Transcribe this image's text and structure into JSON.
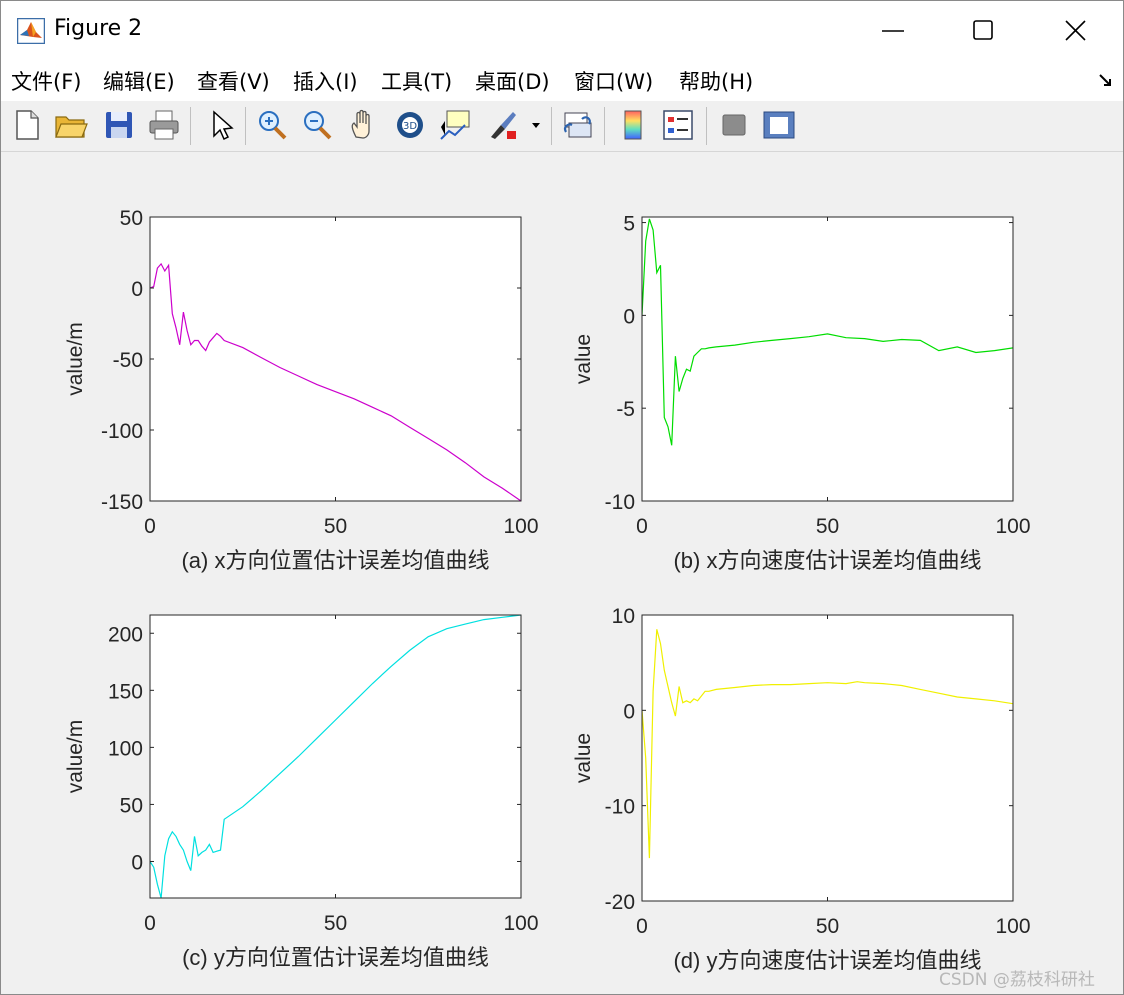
{
  "window": {
    "title": "Figure 2"
  },
  "menu": [
    "文件(F)",
    "编辑(E)",
    "查看(V)",
    "插入(I)",
    "工具(T)",
    "桌面(D)",
    "窗口(W)",
    "帮助(H)"
  ],
  "toolbar": [
    "new-file-icon",
    "open-file-icon",
    "save-icon",
    "print-icon",
    "pointer-icon",
    "zoom-in-icon",
    "zoom-out-icon",
    "pan-icon",
    "rotate-3d-icon",
    "data-cursor-icon",
    "brush-icon",
    "link-plot-icon",
    "colorbar-icon",
    "legend-icon",
    "hide-plot-tools-icon",
    "show-plot-tools-icon"
  ],
  "watermark": "CSDN @荔枝科研社",
  "chart_data": [
    {
      "type": "line",
      "caption": "(a) x方向位置估计误差均值曲线",
      "xlabel": "",
      "ylabel": "value/m",
      "color": "#cc00cc",
      "xlim": [
        0,
        100
      ],
      "ylim": [
        -150,
        50
      ],
      "xticks": [
        0,
        50,
        100
      ],
      "yticks": [
        50,
        0,
        -50,
        -100,
        -150
      ],
      "x": [
        0,
        1,
        2,
        3,
        4,
        5,
        6,
        7,
        8,
        9,
        10,
        11,
        12,
        13,
        14,
        15,
        16,
        17,
        18,
        19,
        20,
        25,
        30,
        35,
        40,
        45,
        50,
        55,
        60,
        65,
        70,
        75,
        80,
        85,
        90,
        95,
        100
      ],
      "y": [
        0,
        1,
        14,
        17,
        12,
        16,
        -18,
        -28,
        -40,
        -17,
        -30,
        -40,
        -37,
        -37,
        -41,
        -44,
        -38,
        -35,
        -32,
        -34,
        -37,
        -42,
        -49,
        -56,
        -62,
        -68,
        -73,
        -78,
        -84,
        -90,
        -98,
        -106,
        -114,
        -123,
        -133,
        -141,
        -150
      ]
    },
    {
      "type": "line",
      "caption": "(b) x方向速度估计误差均值曲线",
      "xlabel": "",
      "ylabel": "value",
      "color": "#00dd00",
      "xlim": [
        0,
        100
      ],
      "ylim": [
        -10,
        5.3
      ],
      "xticks": [
        0,
        50,
        100
      ],
      "yticks": [
        5,
        0,
        -5,
        -10
      ],
      "x": [
        0,
        1,
        2,
        3,
        4,
        5,
        6,
        7,
        8,
        9,
        10,
        11,
        12,
        13,
        14,
        15,
        16,
        17,
        18,
        20,
        25,
        30,
        35,
        40,
        45,
        50,
        55,
        60,
        65,
        70,
        75,
        80,
        85,
        90,
        95,
        100
      ],
      "y": [
        0,
        4.0,
        5.2,
        4.6,
        2.3,
        2.7,
        -5.5,
        -6.0,
        -7.0,
        -2.2,
        -4.1,
        -3.4,
        -2.9,
        -3.0,
        -2.2,
        -2.0,
        -1.8,
        -1.8,
        -1.75,
        -1.7,
        -1.6,
        -1.45,
        -1.35,
        -1.25,
        -1.15,
        -1.0,
        -1.2,
        -1.25,
        -1.4,
        -1.3,
        -1.35,
        -1.9,
        -1.7,
        -2.0,
        -1.9,
        -1.75
      ]
    },
    {
      "type": "line",
      "caption": "(c) y方向位置估计误差均值曲线",
      "xlabel": "",
      "ylabel": "value/m",
      "color": "#00e0e0",
      "xlim": [
        0,
        100
      ],
      "ylim": [
        -32,
        216
      ],
      "xticks": [
        0,
        50,
        100
      ],
      "yticks": [
        200,
        150,
        100,
        50,
        0
      ],
      "x": [
        0,
        1,
        2,
        3,
        4,
        5,
        6,
        7,
        8,
        9,
        10,
        11,
        12,
        13,
        14,
        15,
        16,
        17,
        18,
        19,
        20,
        25,
        30,
        35,
        40,
        45,
        50,
        55,
        60,
        65,
        70,
        75,
        80,
        85,
        90,
        95,
        100
      ],
      "y": [
        0,
        -5,
        -20,
        -32,
        5,
        20,
        26,
        22,
        15,
        10,
        0,
        -8,
        22,
        5,
        8,
        10,
        15,
        8,
        9,
        10,
        37,
        48,
        62,
        77,
        92,
        108,
        124,
        140,
        156,
        171,
        185,
        197,
        204,
        208,
        212,
        214,
        216
      ]
    },
    {
      "type": "line",
      "caption": "(d) y方向速度估计误差均值曲线",
      "xlabel": "",
      "ylabel": "value",
      "color": "#f0f000",
      "xlim": [
        0,
        100
      ],
      "ylim": [
        -20,
        10
      ],
      "xticks": [
        0,
        50,
        100
      ],
      "yticks": [
        10,
        0,
        -10,
        -20
      ],
      "x": [
        0,
        1,
        2,
        3,
        4,
        5,
        6,
        7,
        8,
        9,
        10,
        11,
        12,
        13,
        14,
        15,
        16,
        17,
        18,
        20,
        25,
        30,
        35,
        40,
        45,
        50,
        55,
        58,
        60,
        65,
        70,
        75,
        80,
        85,
        90,
        95,
        100
      ],
      "y": [
        0,
        -5,
        -15.5,
        2.0,
        8.5,
        7.0,
        4.2,
        2.5,
        0.8,
        -0.6,
        2.5,
        0.8,
        1.0,
        0.8,
        1.2,
        1.0,
        1.5,
        2.0,
        2.0,
        2.2,
        2.4,
        2.6,
        2.7,
        2.7,
        2.8,
        2.9,
        2.8,
        3.0,
        2.9,
        2.8,
        2.6,
        2.2,
        1.8,
        1.4,
        1.2,
        1.0,
        0.7
      ]
    }
  ]
}
